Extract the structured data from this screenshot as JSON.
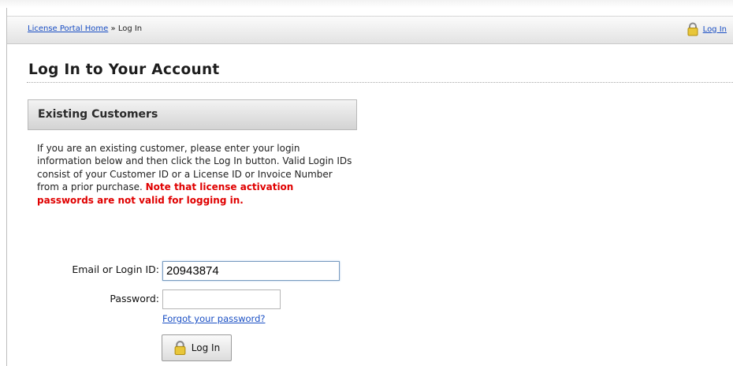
{
  "header": {
    "breadcrumb_home": "License Portal Home",
    "breadcrumb_sep": " » ",
    "breadcrumb_current": "Log In",
    "login_link": "Log In",
    "lock_icon": "padlock-icon"
  },
  "main": {
    "title": "Log In to Your Account",
    "section_title": "Existing Customers",
    "intro_text": "If you are an existing customer, please enter your login information below and then click the Log In button. Valid Login IDs consist of your Customer ID or a License ID or Invoice Number from a prior purchase. ",
    "warning_text": "Note that license activation passwords are not valid for logging in."
  },
  "form": {
    "email_label": "Email or Login ID:",
    "email_value": "20943874",
    "password_label": "Password:",
    "password_value": "",
    "forgot_link": "Forgot your password?",
    "submit_label": "Log In"
  },
  "colors": {
    "link": "#1a4fc4",
    "warning": "#e00000",
    "lock": "#e8c63a"
  }
}
